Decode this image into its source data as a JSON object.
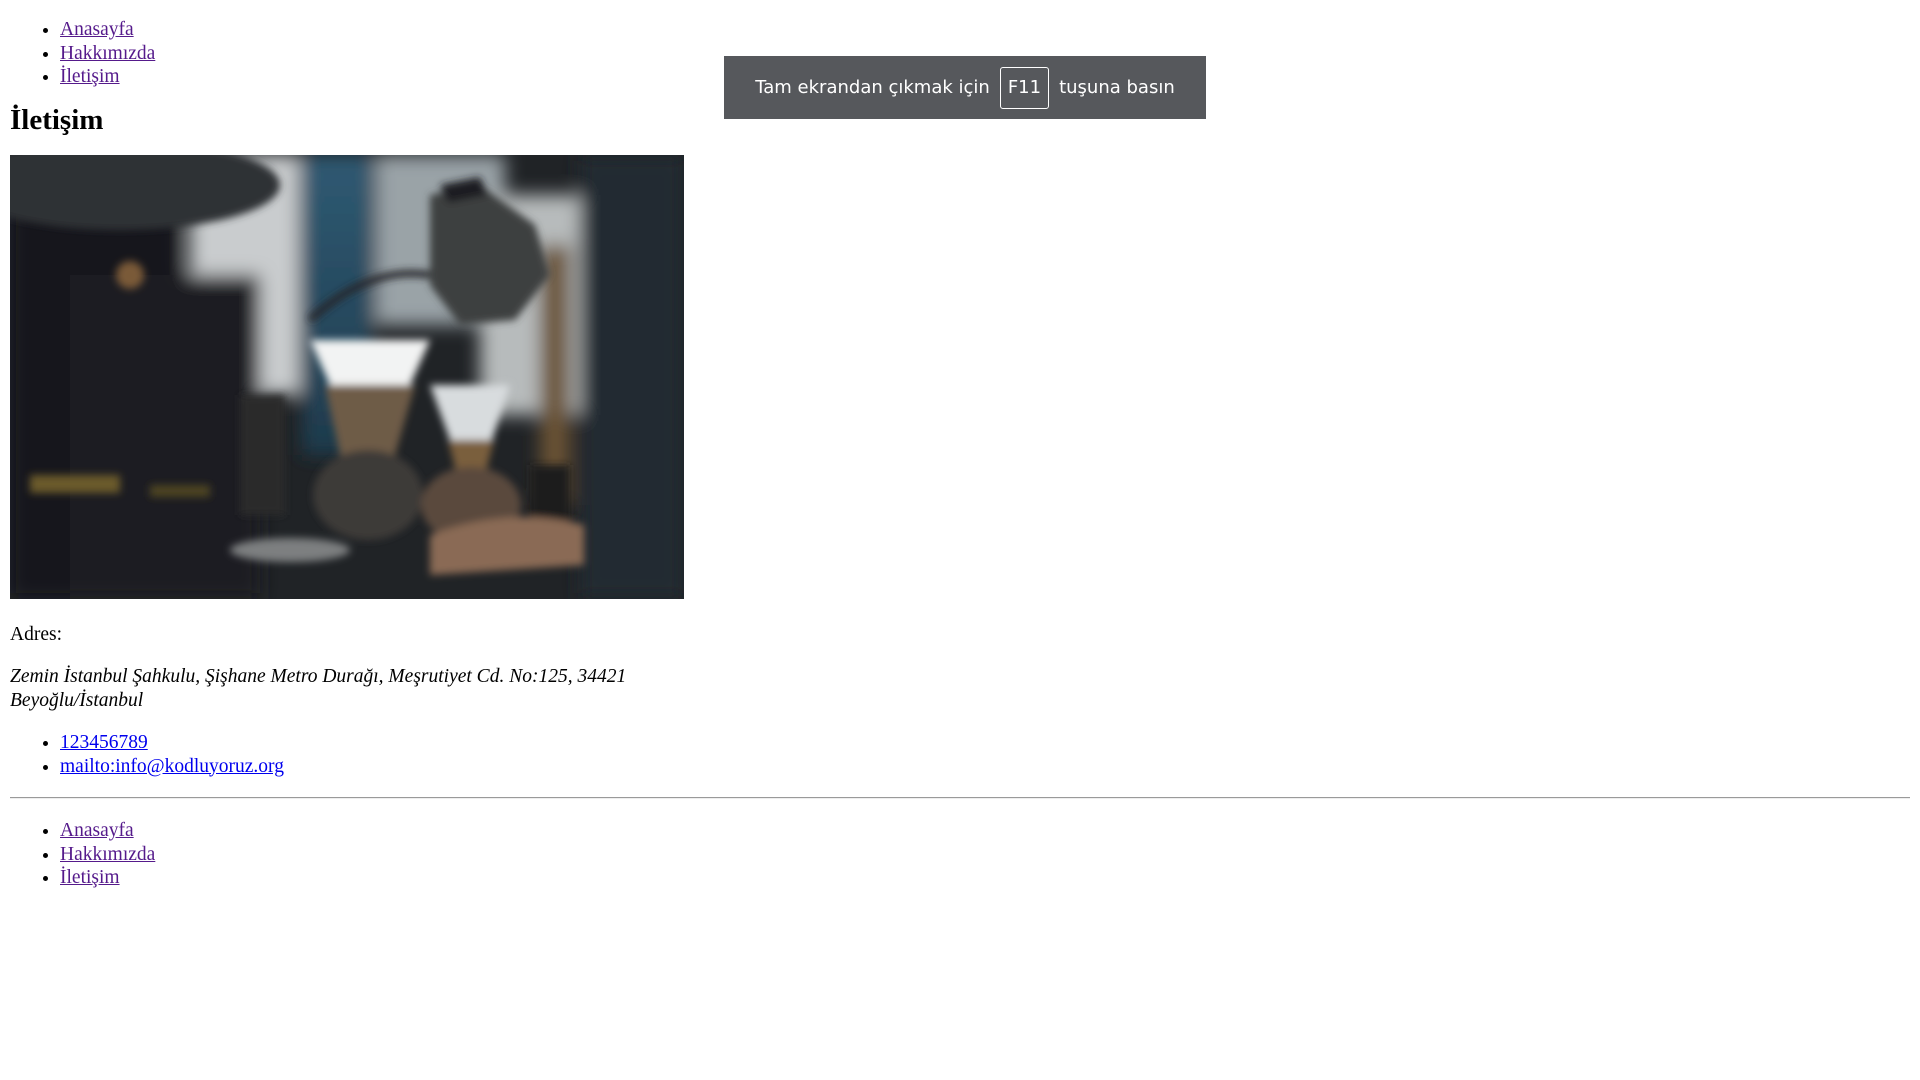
{
  "top_nav": {
    "items": [
      {
        "label": "Anasayfa"
      },
      {
        "label": "Hakkımızda"
      },
      {
        "label": "İletişim"
      }
    ]
  },
  "main": {
    "title": "İletişim",
    "address_label": "Adres:",
    "address_text": "Zemin İstanbul Şahkulu, Şişhane Metro Durağı, Meşrutiyet Cd. No:125, 34421 Beyoğlu/İstanbul",
    "contacts": [
      {
        "label": "123456789"
      },
      {
        "label": "mailto:info@kodluyoruz.org"
      }
    ]
  },
  "footer_nav": {
    "items": [
      {
        "label": "Anasayfa"
      },
      {
        "label": "Hakkımızda"
      },
      {
        "label": "İletişim"
      }
    ]
  },
  "fullscreen_toast": {
    "text_before": "Tam ekrandan çıkmak için",
    "key": "F11",
    "text_after": "tuşuna basın"
  },
  "colors": {
    "visited_link": "#551a8b",
    "link": "#0000ee",
    "toast_bg": "#56585c"
  }
}
